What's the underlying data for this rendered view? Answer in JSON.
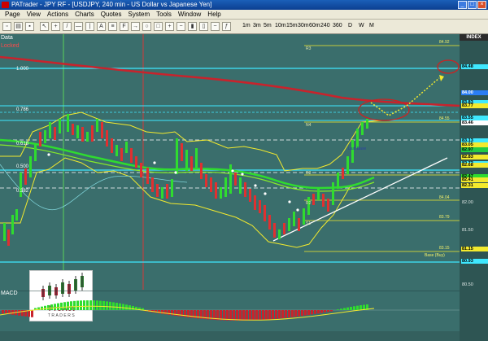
{
  "window": {
    "title": "PATrader - JPY RF - [USDJPY, 240 min - US Dollar vs Japanese Yen]",
    "buttons": [
      "_",
      "□",
      "×"
    ]
  },
  "menu": {
    "items": [
      "Page",
      "View",
      "Actions",
      "Charts",
      "Quotes",
      "System",
      "Tools",
      "Window",
      "Help"
    ]
  },
  "toolbar": {
    "timeframes": [
      "1m",
      "3m",
      "5m",
      "10m",
      "15m",
      "30m",
      "60m",
      "240",
      "360",
      "D",
      "W",
      "M"
    ]
  },
  "panels": {
    "data_label": "Data",
    "locked_label": "Locked",
    "index_label": "INDEX",
    "macd_label": "MACD"
  },
  "fib_levels": [
    "1.000",
    "0.786",
    "0.618",
    "0.500",
    "0.382"
  ],
  "chart_annotations": [
    "R3",
    "R2",
    "N4",
    "R3",
    "R2",
    "R2",
    "S1",
    "S1",
    "Last Base",
    "Base (Buy)"
  ],
  "chart_levels": [
    "84.92",
    "84.55",
    "84.04",
    "83.79",
    "83.15"
  ],
  "price_axis": {
    "labels": [
      "84.48",
      "84.00",
      "83.83",
      "83.77",
      "83.55",
      "83.46",
      "83.13",
      "83.05",
      "82.97",
      "82.83",
      "82.72",
      "82.68",
      "82.47",
      "82.41",
      "82.31",
      "82.00",
      "81.50",
      "81.15",
      "80.93",
      "80.50"
    ],
    "highlight_colors": {
      "83.46": "#ffffff",
      "83.55": "#3fe8ff",
      "83.83": "#3fe8ff",
      "83.77": "#f3ea2e",
      "84.00": "#2a7df5",
      "84.48": "#3fe8ff",
      "83.13": "#3fe8ff",
      "83.05": "#f3ea2e",
      "82.97": "#22cc44",
      "82.83": "#f3ea2e",
      "82.72": "#3fe8ff",
      "82.68": "#f3ea2e",
      "82.47": "#2fdc2f",
      "82.41": "#f3ea2e",
      "82.31": "#f3ea2e",
      "80.93": "#3fe8ff",
      "81.15": "#f3ea2e"
    }
  },
  "logo": {
    "line1": "ProAct",
    "line2": "TRADERS"
  },
  "colors": {
    "background": "#3a6e6c",
    "cyan": "#3fe8ff",
    "yellow": "#f3ea2e",
    "red": "#c8232c",
    "green": "#2fdc2f",
    "white": "#ffffff"
  }
}
